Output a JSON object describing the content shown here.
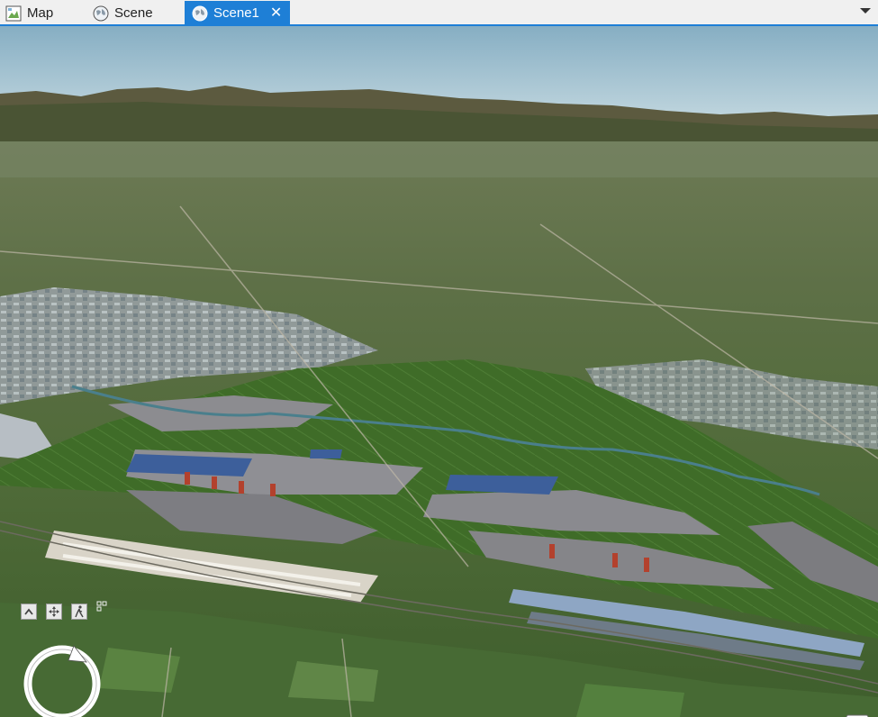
{
  "tabs": [
    {
      "label": "Map",
      "icon": "map-icon",
      "active": false
    },
    {
      "label": "Scene",
      "icon": "globe-icon",
      "active": false
    },
    {
      "label": "Scene1",
      "icon": "globe-icon",
      "active": true,
      "close_label": "✕"
    }
  ],
  "colors": {
    "accent": "#1e7fd6",
    "sky_top": "#8fb5c9",
    "sky_horizon": "#c9dbe2",
    "terrain_far": "#5b6b3c",
    "terrain_mid": "#56703f",
    "field_green": "#3f6c28",
    "building_gray": "#8c8c90"
  },
  "nav_controls": {
    "up_icon": "chevron-up-icon",
    "pan_icon": "pan-arrows-icon",
    "walk_icon": "walk-icon",
    "more_icon": "expand-grid-icon",
    "compass_icon": "navigator-compass-icon",
    "legend_icon": "legend-icon"
  }
}
